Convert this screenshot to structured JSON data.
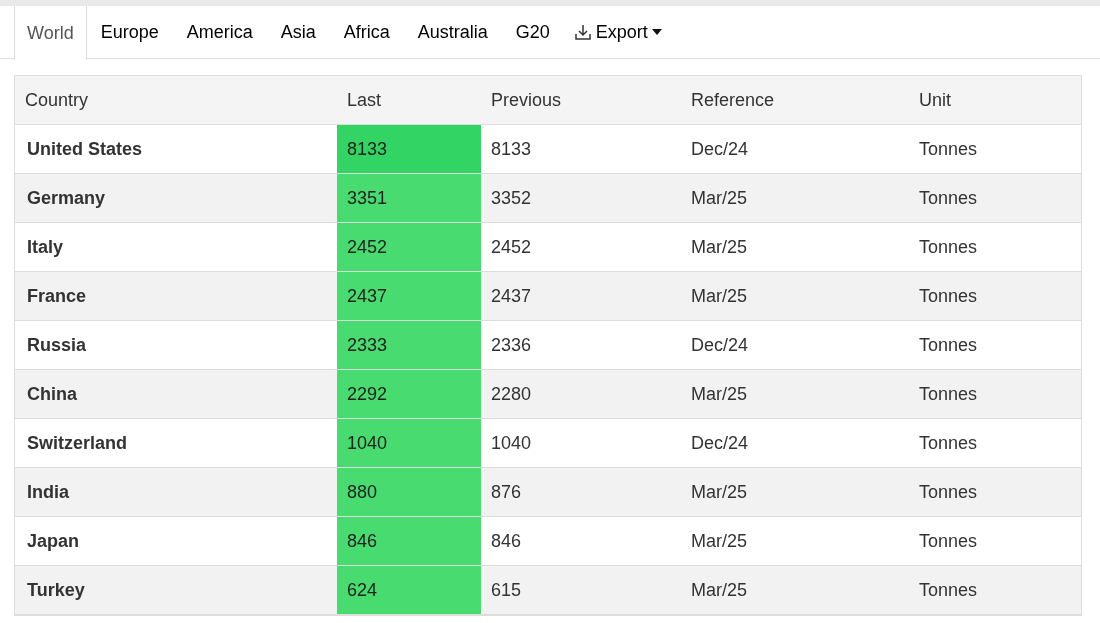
{
  "tabs": [
    {
      "label": "World",
      "selected": true
    },
    {
      "label": "Europe",
      "selected": false
    },
    {
      "label": "America",
      "selected": false
    },
    {
      "label": "Asia",
      "selected": false
    },
    {
      "label": "Africa",
      "selected": false
    },
    {
      "label": "Australia",
      "selected": false
    },
    {
      "label": "G20",
      "selected": false
    }
  ],
  "export_menu": {
    "label": "Export"
  },
  "table": {
    "columns": [
      "Country",
      "Last",
      "Previous",
      "Reference",
      "Unit"
    ],
    "rows": [
      {
        "country": "United States",
        "last": "8133",
        "color": "#32d563",
        "previous": "8133",
        "reference": "Dec/24",
        "unit": "Tonnes"
      },
      {
        "country": "Germany",
        "last": "3351",
        "color": "#48db6f",
        "previous": "3352",
        "reference": "Mar/25",
        "unit": "Tonnes"
      },
      {
        "country": "Italy",
        "last": "2452",
        "color": "#48db6f",
        "previous": "2452",
        "reference": "Mar/25",
        "unit": "Tonnes"
      },
      {
        "country": "France",
        "last": "2437",
        "color": "#48db6f",
        "previous": "2437",
        "reference": "Mar/25",
        "unit": "Tonnes"
      },
      {
        "country": "Russia",
        "last": "2333",
        "color": "#48db6f",
        "previous": "2336",
        "reference": "Dec/24",
        "unit": "Tonnes"
      },
      {
        "country": "China",
        "last": "2292",
        "color": "#48db6f",
        "previous": "2280",
        "reference": "Mar/25",
        "unit": "Tonnes"
      },
      {
        "country": "Switzerland",
        "last": "1040",
        "color": "#48db6f",
        "previous": "1040",
        "reference": "Dec/24",
        "unit": "Tonnes"
      },
      {
        "country": "India",
        "last": "880",
        "color": "#48db6f",
        "previous": "876",
        "reference": "Mar/25",
        "unit": "Tonnes"
      },
      {
        "country": "Japan",
        "last": "846",
        "color": "#48db6f",
        "previous": "846",
        "reference": "Mar/25",
        "unit": "Tonnes"
      },
      {
        "country": "Turkey",
        "last": "624",
        "color": "#48db6f",
        "previous": "615",
        "reference": "Mar/25",
        "unit": "Tonnes"
      }
    ]
  }
}
